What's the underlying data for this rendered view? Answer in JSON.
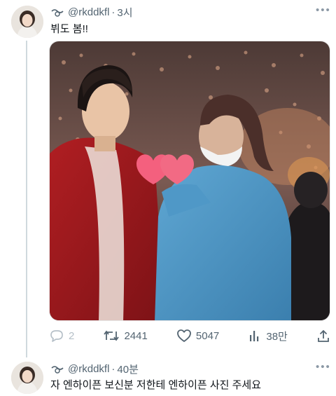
{
  "tweets": [
    {
      "handle": "@rkddkfl",
      "time": "3시",
      "text": "뷔도 봄!!",
      "actions": {
        "replies": "2",
        "retweets": "2441",
        "likes": "5047",
        "views": "38만"
      }
    },
    {
      "handle": "@rkddkfl",
      "time": "40분",
      "text": "자 엔하이픈 보신분 저한테 엔하이픈 사진 주세요"
    }
  ],
  "more_label": "•••",
  "separator": "·",
  "colors": {
    "text": "#0f1419",
    "secondary": "#536471",
    "thread_line": "#cfd9de",
    "heart_sticker": "#f4607e"
  },
  "icons": {
    "handle_icon": "tilde-eye-icon",
    "reply": "reply-icon",
    "retweet": "retweet-icon",
    "like": "heart-icon",
    "views": "views-chart-icon",
    "share": "share-icon"
  }
}
